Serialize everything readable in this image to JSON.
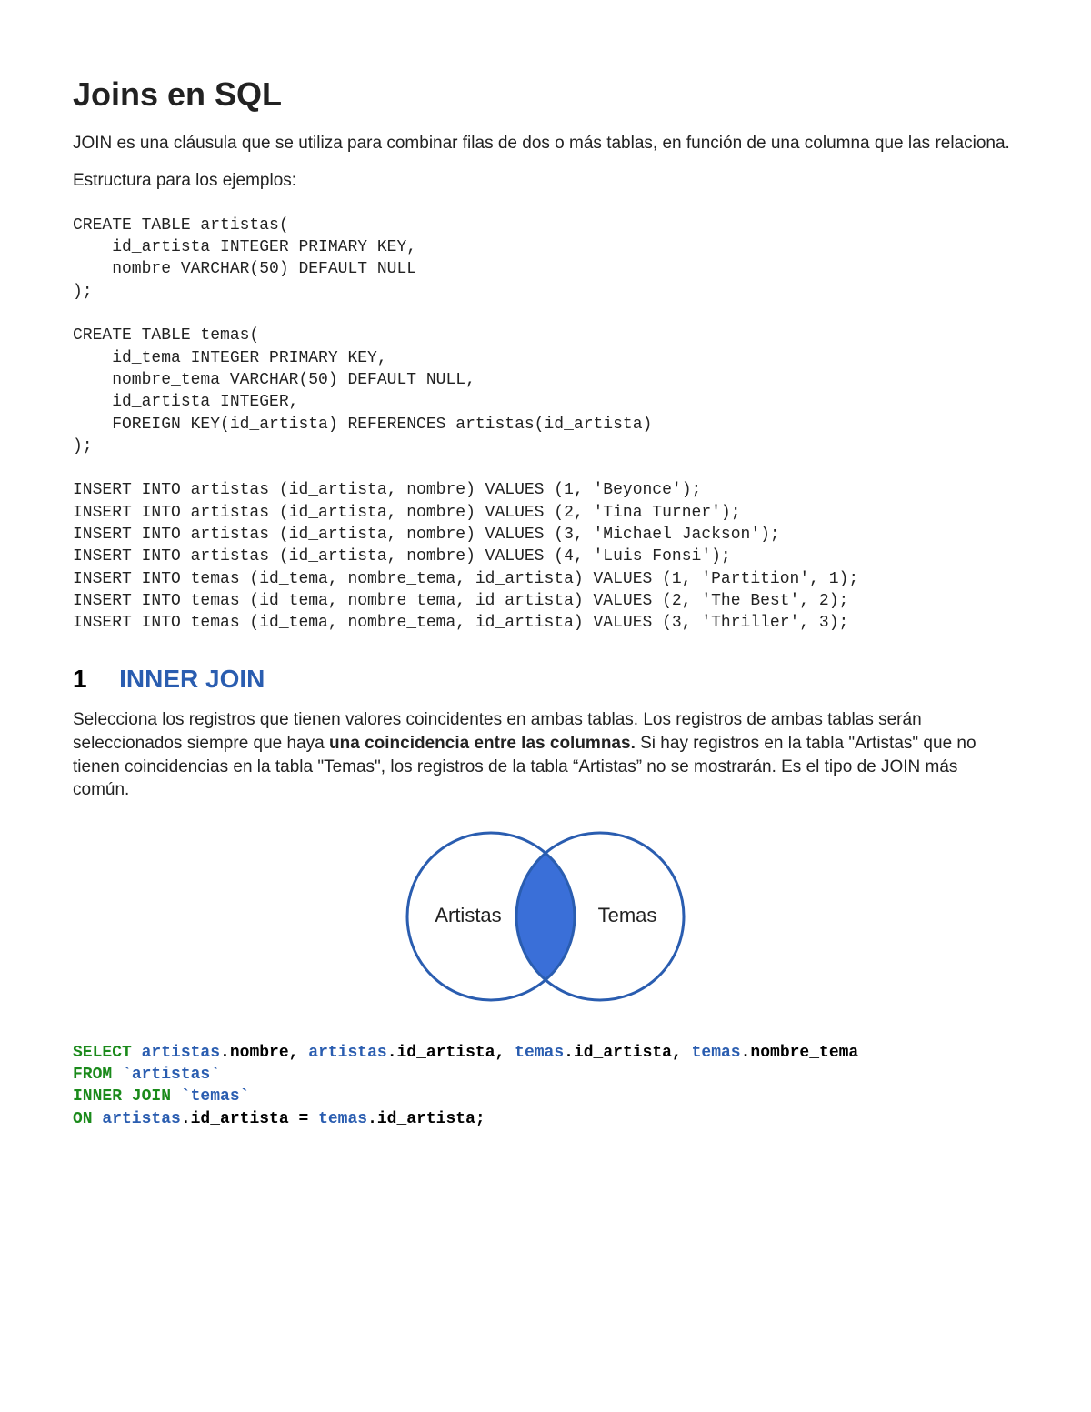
{
  "title": "Joins en SQL",
  "intro1": "JOIN es una cláusula que se utiliza para combinar filas de dos o más tablas, en función de una columna que las relaciona.",
  "intro2": "Estructura para los ejemplos:",
  "schema_code": "CREATE TABLE artistas(\n    id_artista INTEGER PRIMARY KEY,\n    nombre VARCHAR(50) DEFAULT NULL\n);\n\nCREATE TABLE temas(\n    id_tema INTEGER PRIMARY KEY,\n    nombre_tema VARCHAR(50) DEFAULT NULL,\n    id_artista INTEGER,\n    FOREIGN KEY(id_artista) REFERENCES artistas(id_artista)\n);\n\nINSERT INTO artistas (id_artista, nombre) VALUES (1, 'Beyonce');\nINSERT INTO artistas (id_artista, nombre) VALUES (2, 'Tina Turner');\nINSERT INTO artistas (id_artista, nombre) VALUES (3, 'Michael Jackson');\nINSERT INTO artistas (id_artista, nombre) VALUES (4, 'Luis Fonsi');\nINSERT INTO temas (id_tema, nombre_tema, id_artista) VALUES (1, 'Partition', 1);\nINSERT INTO temas (id_tema, nombre_tema, id_artista) VALUES (2, 'The Best', 2);\nINSERT INTO temas (id_tema, nombre_tema, id_artista) VALUES (3, 'Thriller', 3);",
  "section1": {
    "number": "1",
    "title": "INNER JOIN",
    "desc_parts": {
      "p1": "Selecciona los registros que tienen valores coincidentes en ambas tablas. Los registros de ambas tablas serán seleccionados siempre que haya ",
      "bold": "una coincidencia entre las columnas.",
      "p2": " Si hay registros en la tabla \"Artistas\" que no tienen coincidencias en la tabla \"Temas\", los registros de la tabla “Artistas” no se mostrarán. Es el tipo de JOIN más común."
    },
    "venn": {
      "left_label": "Artistas",
      "right_label": "Temas"
    },
    "sql": {
      "select": "SELECT ",
      "tbl_artistas": "artistas",
      "col_nombre": ".nombre",
      "col_id_artista": ".id_artista",
      "tbl_temas": "temas",
      "col_nombre_tema": ".nombre_tema",
      "from": "FROM ",
      "bt_artistas": "`artistas`",
      "inner_join": "INNER JOIN ",
      "bt_temas": "`temas`",
      "on": "ON ",
      "eq": " = ",
      "semicolon": ".id_artista;",
      "comma": ", "
    }
  },
  "colors": {
    "blue": "#2a5db0",
    "green": "#1a8a1a",
    "venn_stroke": "#2a5db0",
    "venn_fill": "#3a6fd8"
  }
}
